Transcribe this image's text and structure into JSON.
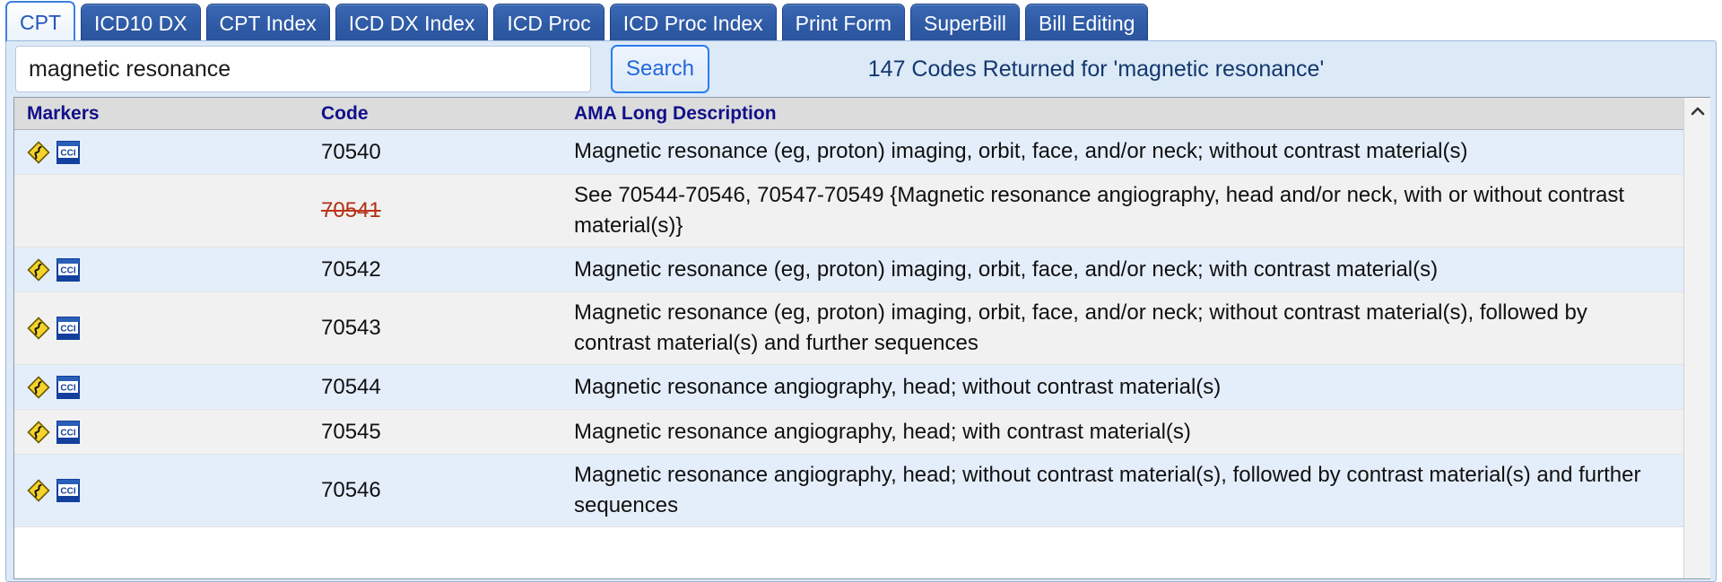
{
  "tabs": [
    {
      "label": "CPT",
      "active": true
    },
    {
      "label": "ICD10 DX",
      "active": false
    },
    {
      "label": "CPT Index",
      "active": false
    },
    {
      "label": "ICD DX Index",
      "active": false
    },
    {
      "label": "ICD Proc",
      "active": false
    },
    {
      "label": "ICD Proc Index",
      "active": false
    },
    {
      "label": "Print Form",
      "active": false
    },
    {
      "label": "SuperBill",
      "active": false
    },
    {
      "label": "Bill Editing",
      "active": false
    }
  ],
  "search": {
    "value": "magnetic resonance",
    "placeholder": "",
    "button_label": "Search",
    "result_count_text": "147 Codes Returned for 'magnetic resonance'"
  },
  "table": {
    "headers": {
      "markers": "Markers",
      "code": "Code",
      "description": "AMA Long Description"
    },
    "rows": [
      {
        "markers": [
          "warning-diamond-icon",
          "cci-icon"
        ],
        "code": "70540",
        "deleted": false,
        "description": "Magnetic resonance (eg, proton) imaging, orbit, face, and/or neck; without contrast material(s)"
      },
      {
        "markers": [],
        "code": "70541",
        "deleted": true,
        "description": "See 70544-70546, 70547-70549 {Magnetic resonance angiography, head and/or neck, with or without contrast material(s)}"
      },
      {
        "markers": [
          "warning-diamond-icon",
          "cci-icon"
        ],
        "code": "70542",
        "deleted": false,
        "description": "Magnetic resonance (eg, proton) imaging, orbit, face, and/or neck; with contrast material(s)"
      },
      {
        "markers": [
          "warning-diamond-icon",
          "cci-icon"
        ],
        "code": "70543",
        "deleted": false,
        "description": "Magnetic resonance (eg, proton) imaging, orbit, face, and/or neck; without contrast material(s), followed by contrast material(s) and further sequences"
      },
      {
        "markers": [
          "warning-diamond-icon",
          "cci-icon"
        ],
        "code": "70544",
        "deleted": false,
        "description": "Magnetic resonance angiography, head; without contrast material(s)"
      },
      {
        "markers": [
          "warning-diamond-icon",
          "cci-icon"
        ],
        "code": "70545",
        "deleted": false,
        "description": "Magnetic resonance angiography, head; with contrast material(s)"
      },
      {
        "markers": [
          "warning-diamond-icon",
          "cci-icon"
        ],
        "code": "70546",
        "deleted": false,
        "description": "Magnetic resonance angiography, head; without contrast material(s), followed by contrast material(s) and further sequences"
      }
    ]
  },
  "scrollbar": {
    "up_arrow": "chevron-up-icon"
  },
  "colors": {
    "tab_blue": "#2f5ba6",
    "active_tab_text": "#2255bb",
    "header_text": "#10108a",
    "deleted_code": "#b03015",
    "panel_bg": "#dce9f7",
    "row_odd": "#e4eefb",
    "row_even": "#f1f1f1"
  }
}
